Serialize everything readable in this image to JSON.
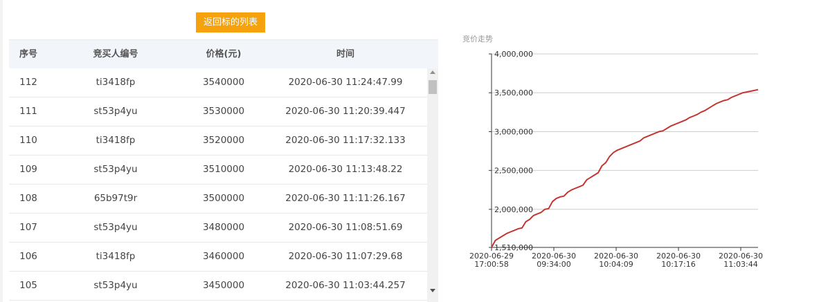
{
  "toolbar": {
    "back_label": "返回标的列表"
  },
  "table": {
    "headers": {
      "seq": "序号",
      "bidder": "竞买人编号",
      "price": "价格(元)",
      "time": "时间"
    },
    "rows": [
      {
        "seq": "112",
        "bidder": "ti3418fp",
        "price": "3540000",
        "time": "2020-06-30 11:24:47.99"
      },
      {
        "seq": "111",
        "bidder": "st53p4yu",
        "price": "3530000",
        "time": "2020-06-30 11:20:39.447"
      },
      {
        "seq": "110",
        "bidder": "ti3418fp",
        "price": "3520000",
        "time": "2020-06-30 11:17:32.133"
      },
      {
        "seq": "109",
        "bidder": "st53p4yu",
        "price": "3510000",
        "time": "2020-06-30 11:13:48.22"
      },
      {
        "seq": "108",
        "bidder": "65b97t9r",
        "price": "3500000",
        "time": "2020-06-30 11:11:26.167"
      },
      {
        "seq": "107",
        "bidder": "st53p4yu",
        "price": "3480000",
        "time": "2020-06-30 11:08:51.69"
      },
      {
        "seq": "106",
        "bidder": "ti3418fp",
        "price": "3460000",
        "time": "2020-06-30 11:07:29.68"
      },
      {
        "seq": "105",
        "bidder": "st53p4yu",
        "price": "3450000",
        "time": "2020-06-30 11:03:44.257"
      }
    ]
  },
  "chart_data": {
    "type": "line",
    "title": "竞价走势",
    "xlabel": "",
    "ylabel": "",
    "ylim": [
      1510000,
      4000000
    ],
    "y_ticks": [
      "4,000,000",
      "3,500,000",
      "3,000,000",
      "2,500,000",
      "2,000,000",
      "1,510,000"
    ],
    "y_tick_values": [
      4000000,
      3500000,
      3000000,
      2500000,
      2000000,
      1510000
    ],
    "x_ticks": [
      {
        "date": "2020-06-29",
        "time": "17:00:58"
      },
      {
        "date": "2020-06-30",
        "time": "09:34:00"
      },
      {
        "date": "2020-06-30",
        "time": "10:04:09"
      },
      {
        "date": "2020-06-30",
        "time": "10:17:16"
      },
      {
        "date": "2020-06-30",
        "time": "11:03:44"
      }
    ],
    "grid": true,
    "line_color": "#c23531",
    "series": [
      {
        "values": [
          1510000,
          1600000,
          1630000,
          1660000,
          1690000,
          1710000,
          1730000,
          1750000,
          1760000,
          1840000,
          1870000,
          1920000,
          1940000,
          1960000,
          2000000,
          2010000,
          2100000,
          2140000,
          2160000,
          2170000,
          2220000,
          2250000,
          2270000,
          2290000,
          2310000,
          2380000,
          2410000,
          2440000,
          2470000,
          2560000,
          2600000,
          2680000,
          2730000,
          2760000,
          2780000,
          2800000,
          2820000,
          2840000,
          2860000,
          2880000,
          2920000,
          2940000,
          2960000,
          2980000,
          3000000,
          3010000,
          3040000,
          3070000,
          3090000,
          3110000,
          3130000,
          3150000,
          3180000,
          3200000,
          3220000,
          3250000,
          3270000,
          3300000,
          3330000,
          3360000,
          3380000,
          3400000,
          3410000,
          3440000,
          3460000,
          3480000,
          3500000,
          3510000,
          3520000,
          3530000,
          3540000
        ]
      }
    ]
  }
}
